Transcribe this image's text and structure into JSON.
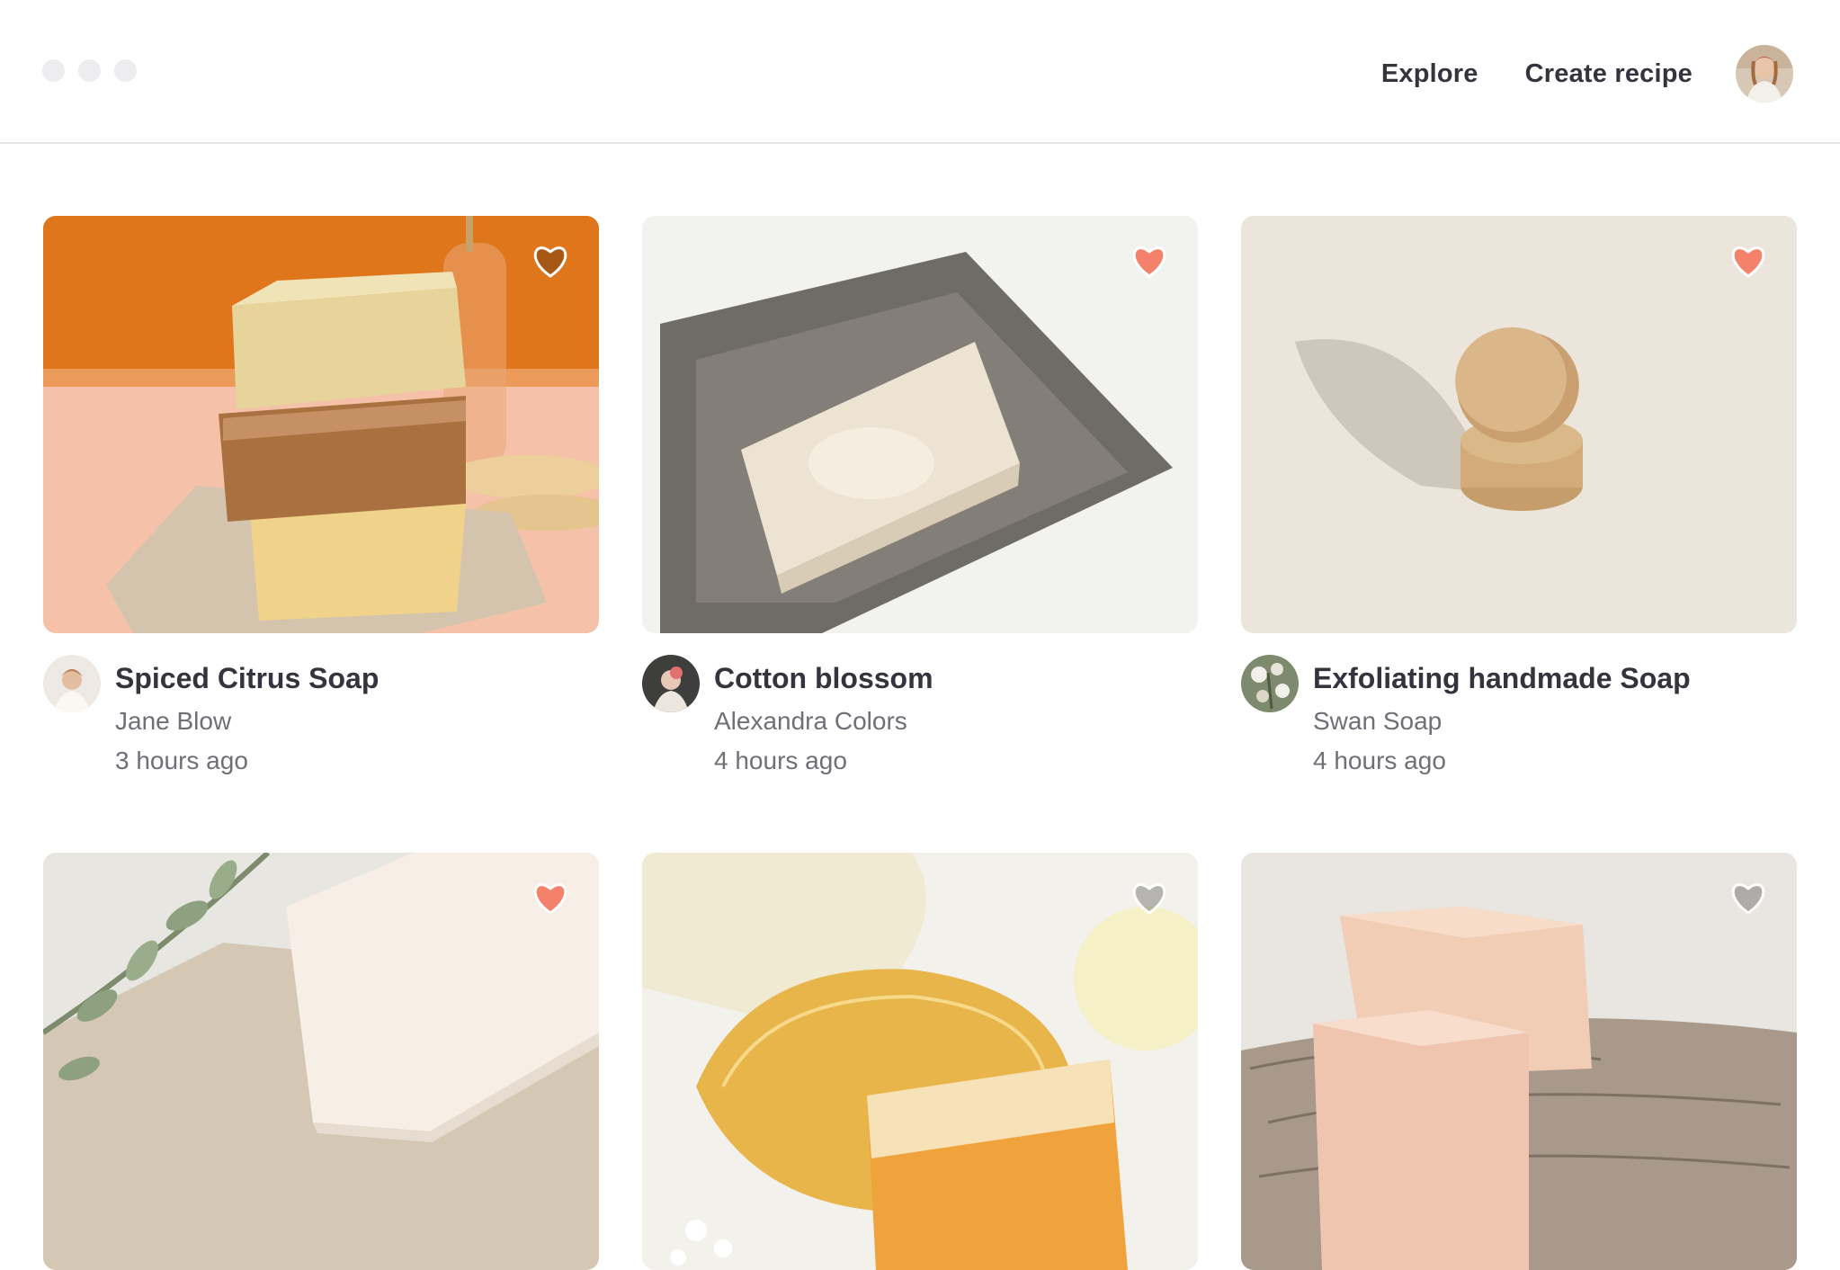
{
  "window": {
    "controls": [
      "close",
      "minimize",
      "maximize"
    ]
  },
  "nav": {
    "explore_label": "Explore",
    "create_label": "Create recipe",
    "avatar_icon": "user-avatar"
  },
  "colors": {
    "heart_liked": "#f4826b",
    "heart_unliked": "#ffffff",
    "text_primary": "#34343f",
    "text_secondary": "#6f6f77"
  },
  "recipes": [
    {
      "title": "Spiced Citrus Soap",
      "author": "Jane Blow",
      "time": "3 hours ago",
      "liked": false
    },
    {
      "title": "Cotton blossom",
      "author": "Alexandra Colors",
      "time": "4 hours ago",
      "liked": true
    },
    {
      "title": "Exfoliating handmade Soap",
      "author": "Swan Soap",
      "time": "4 hours ago",
      "liked": true
    },
    {
      "title": "",
      "author": "",
      "time": "",
      "liked": true
    },
    {
      "title": "",
      "author": "",
      "time": "",
      "liked": false
    },
    {
      "title": "",
      "author": "",
      "time": "",
      "liked": false
    }
  ]
}
